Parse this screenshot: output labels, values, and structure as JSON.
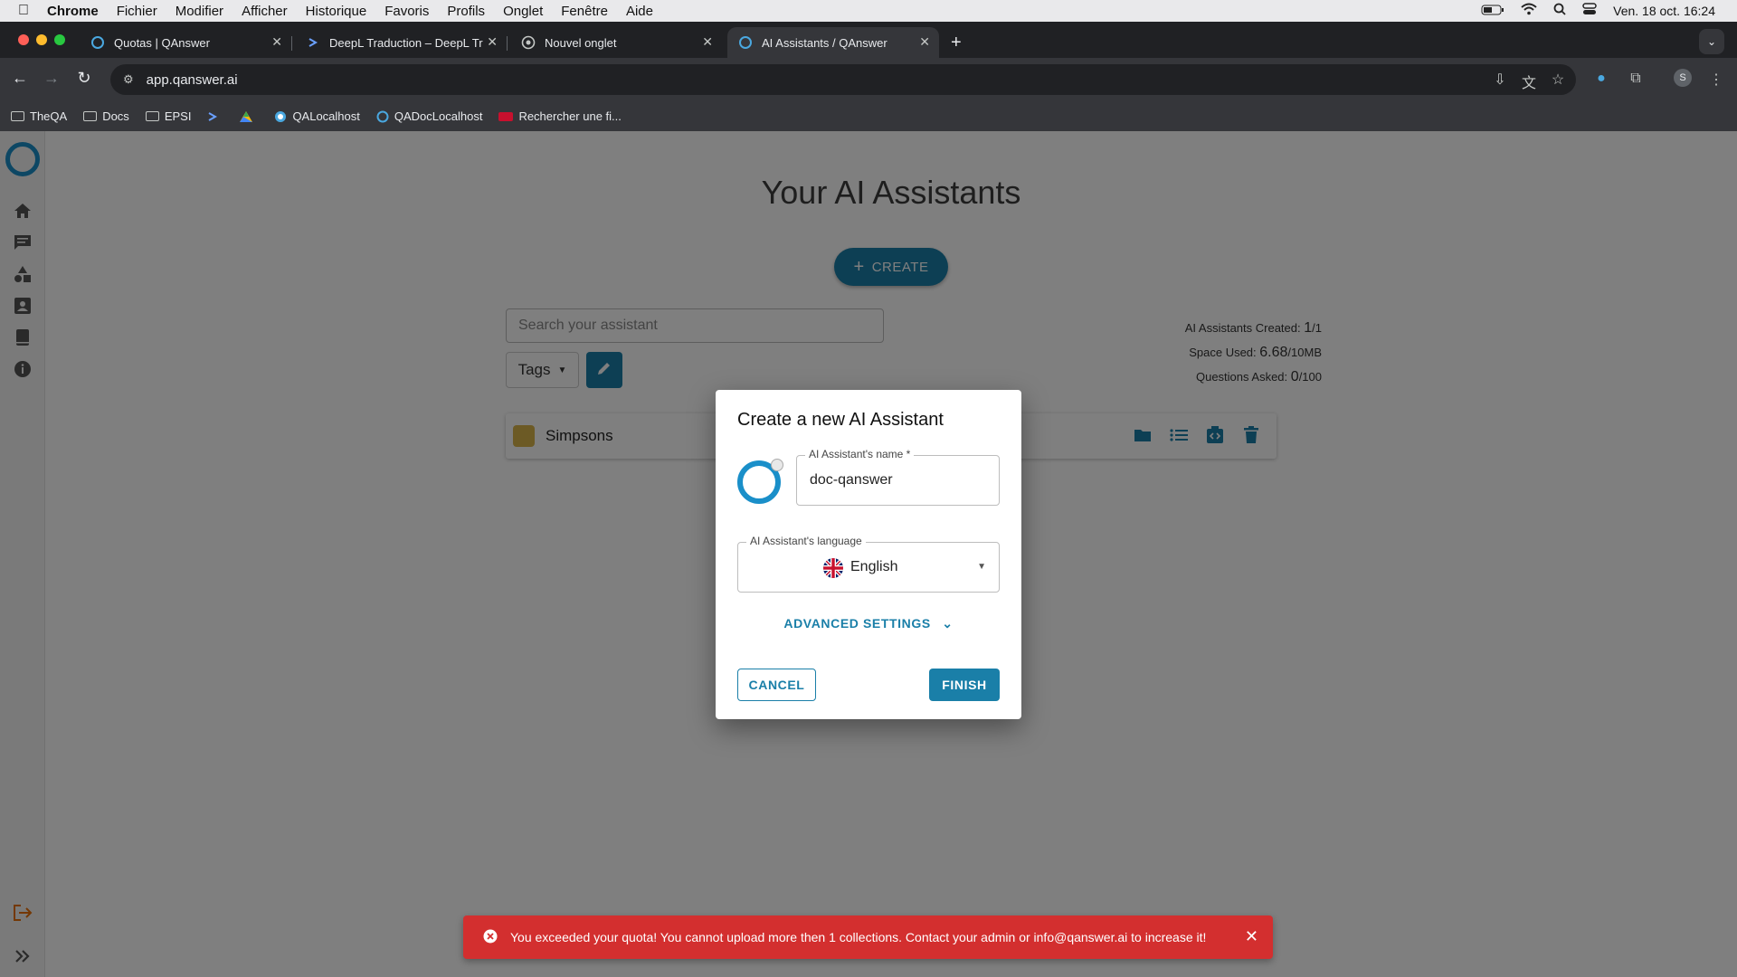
{
  "menubar": {
    "app": "Chrome",
    "items": [
      "Fichier",
      "Modifier",
      "Afficher",
      "Historique",
      "Favoris",
      "Profils",
      "Onglet",
      "Fenêtre",
      "Aide"
    ],
    "datetime": "Ven. 18 oct.  16:24"
  },
  "tabs": [
    {
      "label": "Quotas | QAnswer"
    },
    {
      "label": "DeepL Traduction – DeepL Tr"
    },
    {
      "label": "Nouvel onglet"
    },
    {
      "label": "AI Assistants / QAnswer"
    }
  ],
  "omnibox": {
    "url": "app.qanswer.ai"
  },
  "profile_initial": "S",
  "bookmarks": [
    {
      "label": "TheQA"
    },
    {
      "label": "Docs"
    },
    {
      "label": "EPSI"
    },
    {
      "label": ""
    },
    {
      "label": ""
    },
    {
      "label": "QALocalhost"
    },
    {
      "label": "QADocLocalhost"
    },
    {
      "label": "Rechercher une fi..."
    }
  ],
  "page": {
    "title": "Your AI Assistants",
    "create_label": "CREATE",
    "search_placeholder": "Search your assistant",
    "tags_label": "Tags",
    "stats": {
      "created_label": "AI Assistants Created:",
      "created_value": "1",
      "created_max": "/1",
      "space_label": "Space Used:",
      "space_value": "6.68",
      "space_max": "/10MB",
      "questions_label": "Questions Asked:",
      "questions_value": "0",
      "questions_max": "/100"
    },
    "assistants": [
      {
        "name": "Simpsons"
      }
    ]
  },
  "dialog": {
    "title": "Create a new AI Assistant",
    "name_label": "AI Assistant's name *",
    "name_value": "doc-qanswer",
    "language_label": "AI Assistant's language",
    "language_value": "English",
    "advanced_label": "ADVANCED SETTINGS",
    "cancel_label": "CANCEL",
    "finish_label": "FINISH"
  },
  "toast": {
    "message": "You exceeded your quota! You cannot upload more then 1 collections. Contact your admin or info@qanswer.ai to increase it!"
  },
  "colors": {
    "accent": "#1a7fa8",
    "error": "#d32f2f",
    "chrome_dark": "#202124",
    "chrome_toolbar": "#35363a"
  }
}
